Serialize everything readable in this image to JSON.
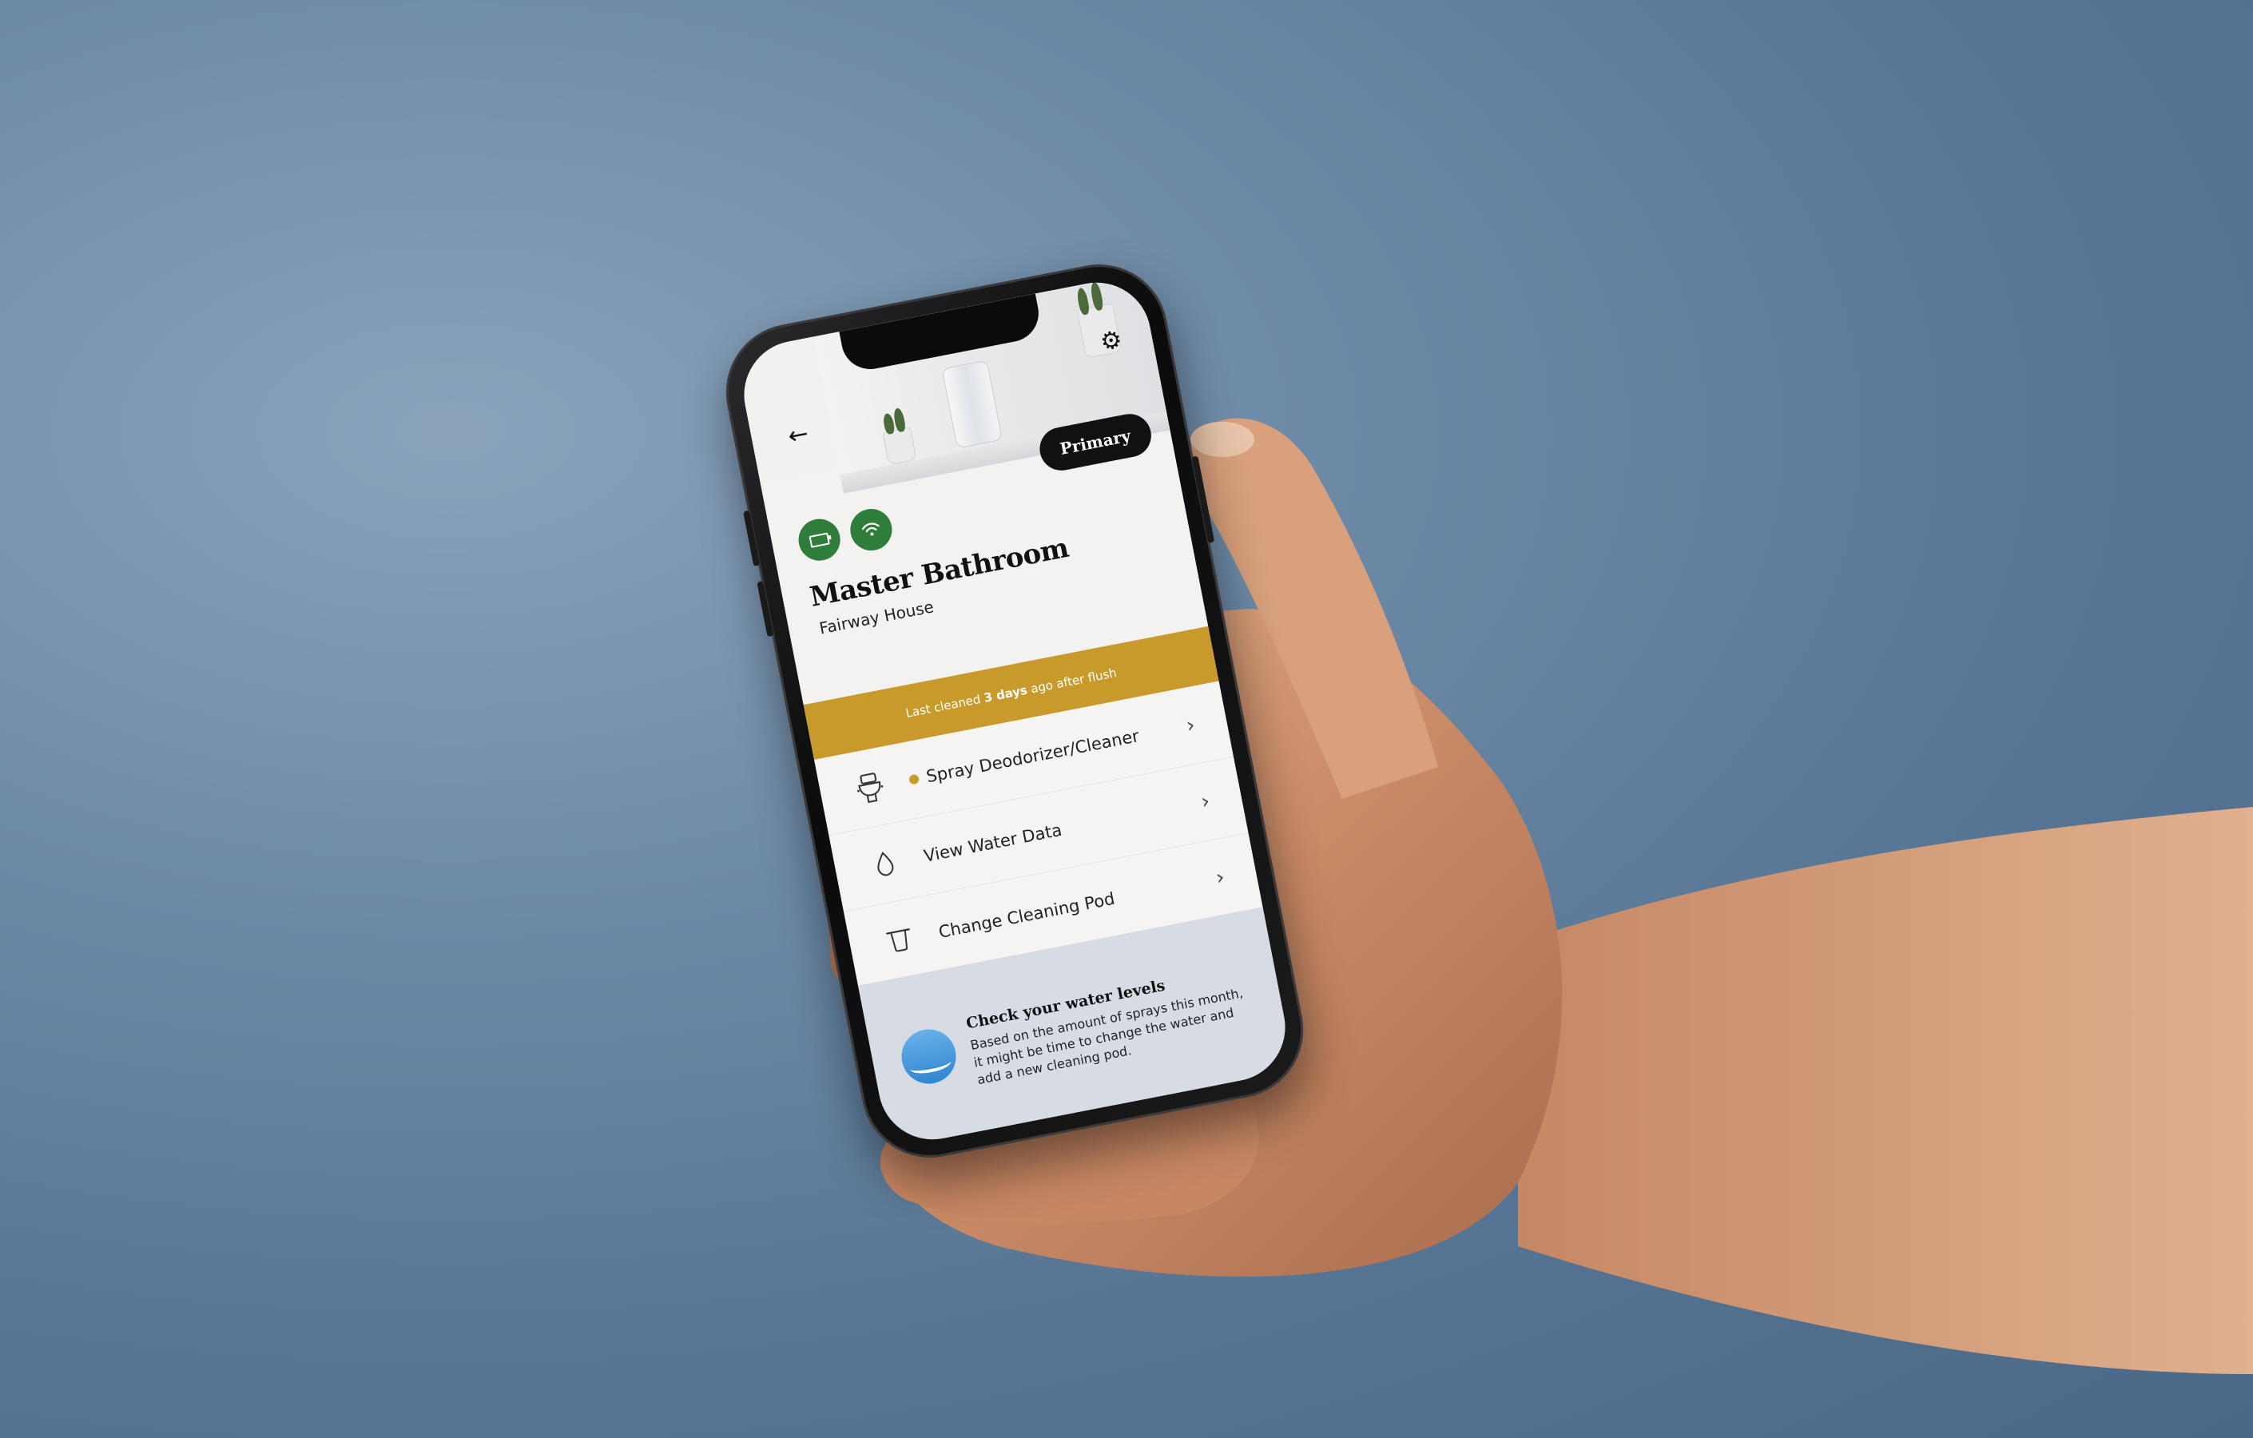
{
  "header": {
    "back_icon": "arrow-left-icon",
    "settings_icon": "gear-icon",
    "badge": "Primary"
  },
  "device": {
    "status_icons": [
      "battery-icon",
      "wifi-icon"
    ],
    "status_color": "#2f7d3b",
    "room_name": "Master Bathroom",
    "location": "Fairway House"
  },
  "banner": {
    "prefix": "Last cleaned ",
    "highlight": "3 days",
    "suffix": " ago after flush",
    "color": "#c89a2c"
  },
  "actions": [
    {
      "icon": "toilet-spray-icon",
      "label": "Spray Deodorizer/Cleaner",
      "alert": true
    },
    {
      "icon": "water-drop-icon",
      "label": "View Water Data",
      "alert": false
    },
    {
      "icon": "cleaning-pod-icon",
      "label": "Change Cleaning Pod",
      "alert": false
    }
  ],
  "tip": {
    "icon": "water-level-icon",
    "title": "Check your water levels",
    "body": "Based on the amount of sprays this month, it might be time to change the water and add a new cleaning pod."
  }
}
